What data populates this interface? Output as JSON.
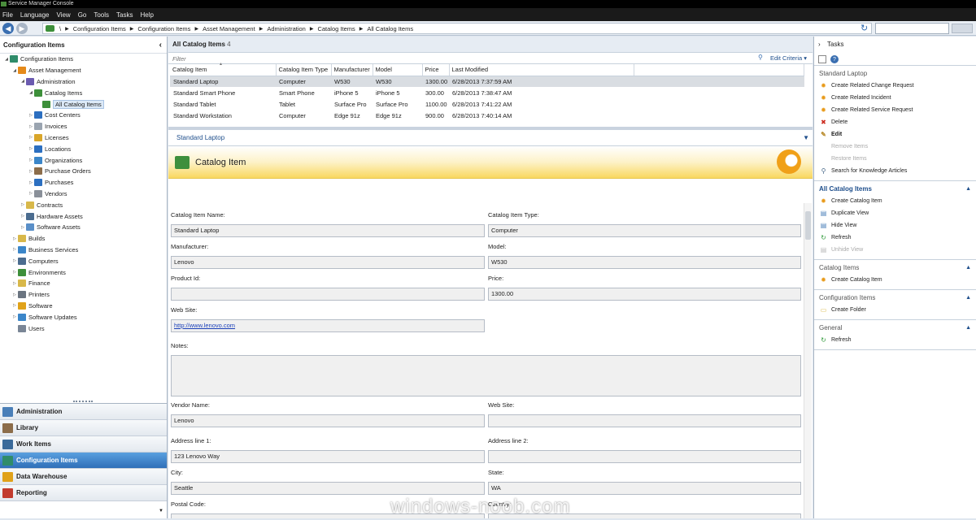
{
  "window": {
    "title": "Service Manager Console"
  },
  "menu": [
    "File",
    "Language",
    "View",
    "Go",
    "Tools",
    "Tasks",
    "Help"
  ],
  "breadcrumb": [
    "\\",
    "Configuration Items",
    "Configuration Items",
    "Asset Management",
    "Administration",
    "Catalog Items",
    "All Catalog Items"
  ],
  "left_panel": {
    "title": "Configuration Items",
    "tree": [
      {
        "label": "Configuration Items",
        "indent": 0,
        "arrow": "open",
        "icon": "#2f8c6a"
      },
      {
        "label": "Asset Management",
        "indent": 1,
        "arrow": "open",
        "icon": "#e58a1a"
      },
      {
        "label": "Administration",
        "indent": 2,
        "arrow": "open",
        "icon": "#6b5bb0"
      },
      {
        "label": "Catalog Items",
        "indent": 3,
        "arrow": "open",
        "icon": "#3d8f3a"
      },
      {
        "label": "All Catalog Items",
        "indent": 4,
        "arrow": "",
        "icon": "#3d8f3a",
        "selected": true
      },
      {
        "label": "Cost Centers",
        "indent": 3,
        "arrow": "closed",
        "icon": "#2c6fc0"
      },
      {
        "label": "Invoices",
        "indent": 3,
        "arrow": "closed",
        "icon": "#9aa4b0"
      },
      {
        "label": "Licenses",
        "indent": 3,
        "arrow": "closed",
        "icon": "#d9a62a"
      },
      {
        "label": "Locations",
        "indent": 3,
        "arrow": "closed",
        "icon": "#2c6fc0"
      },
      {
        "label": "Organizations",
        "indent": 3,
        "arrow": "closed",
        "icon": "#3b86c9"
      },
      {
        "label": "Purchase Orders",
        "indent": 3,
        "arrow": "closed",
        "icon": "#8c6d4a"
      },
      {
        "label": "Purchases",
        "indent": 3,
        "arrow": "closed",
        "icon": "#2c6fc0"
      },
      {
        "label": "Vendors",
        "indent": 3,
        "arrow": "closed",
        "icon": "#8a9099"
      },
      {
        "label": "Contracts",
        "indent": 2,
        "arrow": "closed",
        "icon": "#d8b84a"
      },
      {
        "label": "Hardware Assets",
        "indent": 2,
        "arrow": "closed",
        "icon": "#4b6c8f"
      },
      {
        "label": "Software Assets",
        "indent": 2,
        "arrow": "closed",
        "icon": "#5a8fc8"
      },
      {
        "label": "Builds",
        "indent": 1,
        "arrow": "closed",
        "icon": "#d8b84a"
      },
      {
        "label": "Business Services",
        "indent": 1,
        "arrow": "closed",
        "icon": "#3b86c9"
      },
      {
        "label": "Computers",
        "indent": 1,
        "arrow": "closed",
        "icon": "#4b6c8f"
      },
      {
        "label": "Environments",
        "indent": 1,
        "arrow": "closed",
        "icon": "#3d8f3a"
      },
      {
        "label": "Finance",
        "indent": 1,
        "arrow": "closed",
        "icon": "#d8b84a"
      },
      {
        "label": "Printers",
        "indent": 1,
        "arrow": "closed",
        "icon": "#6a7480"
      },
      {
        "label": "Software",
        "indent": 1,
        "arrow": "closed",
        "icon": "#e0a21a"
      },
      {
        "label": "Software Updates",
        "indent": 1,
        "arrow": "closed",
        "icon": "#3b86c9"
      },
      {
        "label": "Users",
        "indent": 1,
        "arrow": "",
        "icon": "#7a8696"
      }
    ]
  },
  "wunderbar": [
    {
      "label": "Administration",
      "icon": "#4a7fb8",
      "active": false
    },
    {
      "label": "Library",
      "icon": "#8c6d4a",
      "active": false
    },
    {
      "label": "Work Items",
      "icon": "#3a6a9a",
      "active": false
    },
    {
      "label": "Configuration Items",
      "icon": "#2f8c6a",
      "active": true
    },
    {
      "label": "Data Warehouse",
      "icon": "#e0a21a",
      "active": false
    },
    {
      "label": "Reporting",
      "icon": "#c23b2e",
      "active": false
    }
  ],
  "list": {
    "title": "All Catalog Items",
    "count": "4",
    "filter_placeholder": "Filter",
    "edit_criteria": "Edit Criteria",
    "columns": [
      "Catalog Item",
      "Catalog Item Type",
      "Manufacturer",
      "Model",
      "Price",
      "Last Modified"
    ],
    "rows": [
      [
        "Standard Laptop",
        "Computer",
        "W530",
        "W530",
        "1300.00",
        "6/28/2013 7:37:59 AM"
      ],
      [
        "Standard Smart Phone",
        "Smart Phone",
        "iPhone 5",
        "iPhone 5",
        "300.00",
        "6/28/2013 7:38:47 AM"
      ],
      [
        "Standard Tablet",
        "Tablet",
        "Surface Pro",
        "Surface Pro",
        "1100.00",
        "6/28/2013 7:41:22 AM"
      ],
      [
        "Standard Workstation",
        "Computer",
        "Edge 91z",
        "Edge 91z",
        "900.00",
        "6/28/2013 7:40:14 AM"
      ]
    ]
  },
  "detail": {
    "header": "Standard Laptop",
    "form_title": "Catalog Item",
    "fields": {
      "catalog_item_name": {
        "label": "Catalog Item Name:",
        "value": "Standard Laptop"
      },
      "catalog_item_type": {
        "label": "Catalog Item Type:",
        "value": "Computer"
      },
      "manufacturer": {
        "label": "Manufacturer:",
        "value": "Lenovo"
      },
      "model": {
        "label": "Model:",
        "value": "W530"
      },
      "product_id": {
        "label": "Product Id:",
        "value": ""
      },
      "price": {
        "label": "Price:",
        "value": "1300.00"
      },
      "web_site": {
        "label": "Web Site:",
        "value": "http://www.lenovo.com"
      },
      "notes": {
        "label": "Notes:",
        "value": ""
      },
      "vendor_name": {
        "label": "Vendor Name:",
        "value": "Lenovo"
      },
      "vendor_web_site": {
        "label": "Web Site:",
        "value": ""
      },
      "address1": {
        "label": "Address line 1:",
        "value": "123 Lenovo Way"
      },
      "address2": {
        "label": "Address line 2:",
        "value": ""
      },
      "city": {
        "label": "City:",
        "value": "Seattle"
      },
      "state": {
        "label": "State:",
        "value": "WA"
      },
      "postal_code": {
        "label": "Postal Code:",
        "value": ""
      },
      "country": {
        "label": "Country:",
        "value": ""
      }
    }
  },
  "tasks": {
    "title": "Tasks",
    "sections": [
      {
        "title": "Standard Laptop",
        "bold": false,
        "collapse": "",
        "items": [
          {
            "label": "Create Related Change Request",
            "icon": "✹",
            "color": "#e89a1a",
            "disabled": false,
            "bold": false
          },
          {
            "label": "Create Related Incident",
            "icon": "✹",
            "color": "#e89a1a",
            "disabled": false,
            "bold": false
          },
          {
            "label": "Create Related Service Request",
            "icon": "✹",
            "color": "#e89a1a",
            "disabled": false,
            "bold": false
          },
          {
            "label": "Delete",
            "icon": "✖",
            "color": "#cc2a1e",
            "disabled": false,
            "bold": false
          },
          {
            "label": "Edit",
            "icon": "✎",
            "color": "#b88a2a",
            "disabled": false,
            "bold": true
          },
          {
            "label": "Remove Items",
            "icon": "",
            "color": "#bbb",
            "disabled": true,
            "bold": false
          },
          {
            "label": "Restore Items",
            "icon": "",
            "color": "#bbb",
            "disabled": true,
            "bold": false
          },
          {
            "label": "Search for Knowledge Articles",
            "icon": "⚲",
            "color": "#4a6a8a",
            "disabled": false,
            "bold": false
          }
        ]
      },
      {
        "title": "All Catalog Items",
        "bold": true,
        "collapse": "▲",
        "items": [
          {
            "label": "Create Catalog Item",
            "icon": "✹",
            "color": "#e89a1a",
            "disabled": false,
            "bold": false
          },
          {
            "label": "Duplicate View",
            "icon": "▤",
            "color": "#4a7fb8",
            "disabled": false,
            "bold": false
          },
          {
            "label": "Hide View",
            "icon": "▤",
            "color": "#4a7fb8",
            "disabled": false,
            "bold": false
          },
          {
            "label": "Refresh",
            "icon": "↻",
            "color": "#2f9a3a",
            "disabled": false,
            "bold": false
          },
          {
            "label": "Unhide View",
            "icon": "▤",
            "color": "#bbb",
            "disabled": true,
            "bold": false
          }
        ]
      },
      {
        "title": "Catalog Items",
        "bold": false,
        "collapse": "▲",
        "items": [
          {
            "label": "Create Catalog Item",
            "icon": "✹",
            "color": "#e89a1a",
            "disabled": false,
            "bold": false
          }
        ]
      },
      {
        "title": "Configuration Items",
        "bold": false,
        "collapse": "▲",
        "items": [
          {
            "label": "Create Folder",
            "icon": "▭",
            "color": "#d8b84a",
            "disabled": false,
            "bold": false
          }
        ]
      },
      {
        "title": "General",
        "bold": false,
        "collapse": "▲",
        "items": [
          {
            "label": "Refresh",
            "icon": "↻",
            "color": "#2f9a3a",
            "disabled": false,
            "bold": false
          }
        ]
      }
    ]
  },
  "watermark": "windows-noob.com"
}
